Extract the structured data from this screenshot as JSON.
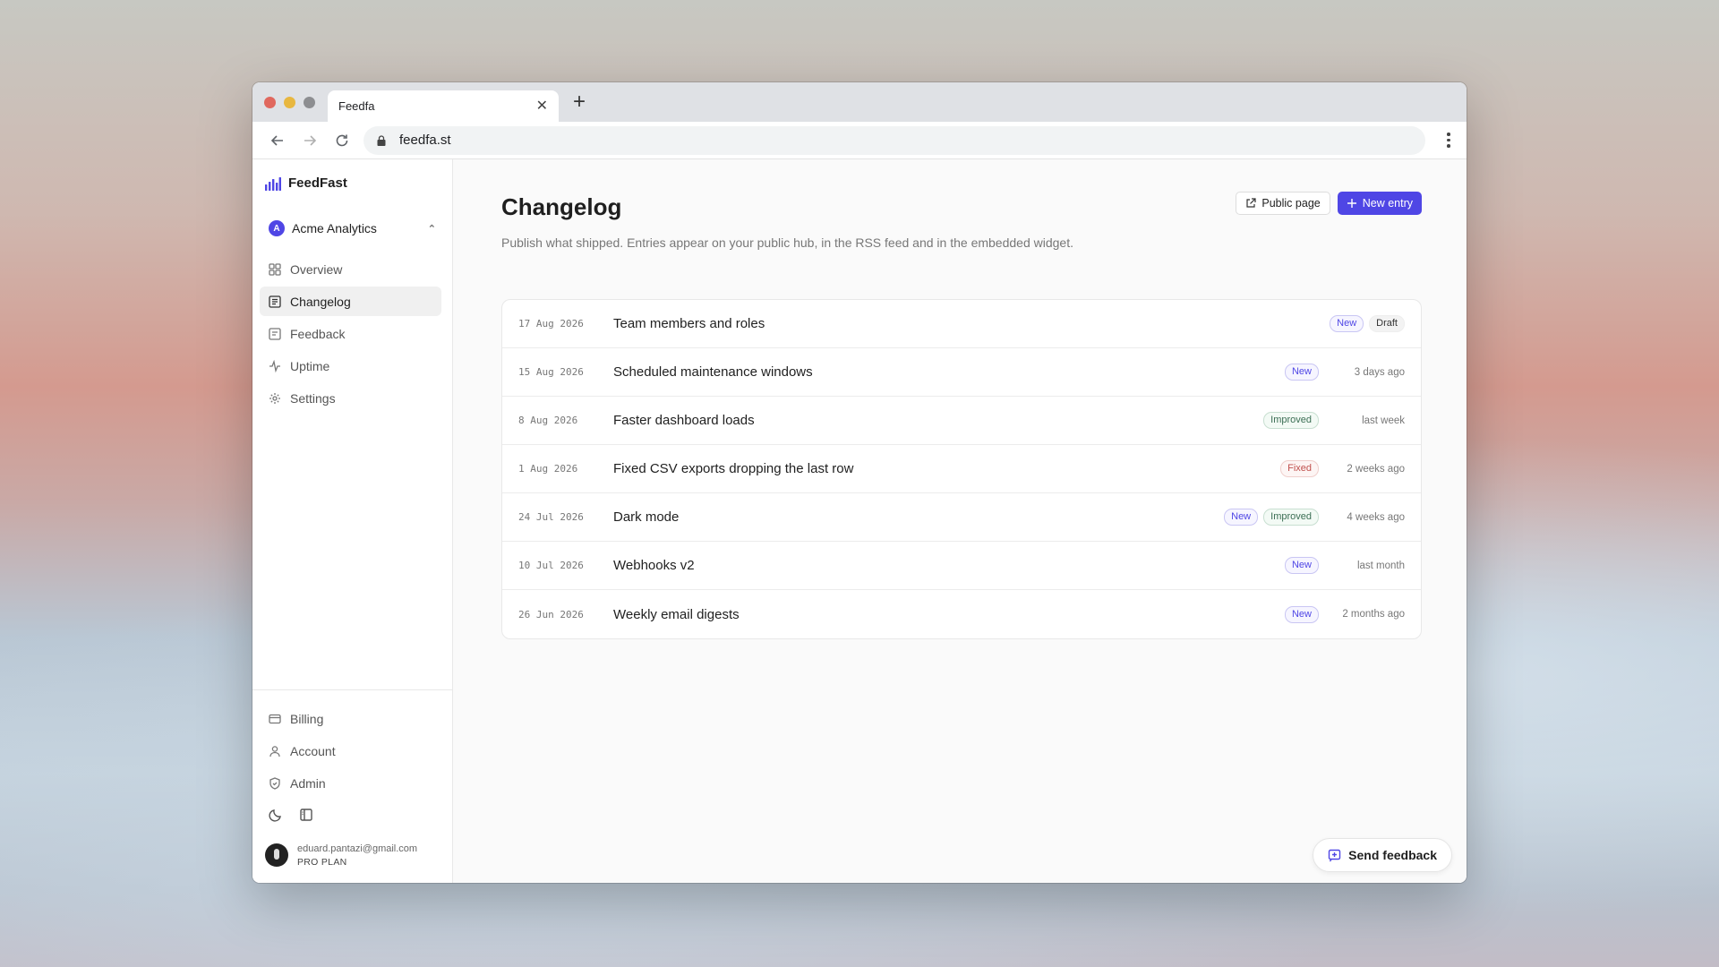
{
  "browser": {
    "tab_title": "Feedfa",
    "url": "feedfa.st"
  },
  "sidebar": {
    "brand": "FeedFast",
    "org": {
      "badge": "A",
      "name": "Acme Analytics"
    },
    "items": [
      {
        "label": "Overview",
        "icon": "grid-icon"
      },
      {
        "label": "Changelog",
        "icon": "changelog-icon",
        "active": true
      },
      {
        "label": "Feedback",
        "icon": "message-icon"
      },
      {
        "label": "Uptime",
        "icon": "activity-icon"
      },
      {
        "label": "Settings",
        "icon": "gear-icon"
      }
    ],
    "bottom_items": [
      {
        "label": "Billing",
        "icon": "credit-card-icon"
      },
      {
        "label": "Account",
        "icon": "user-icon"
      },
      {
        "label": "Admin",
        "icon": "shield-icon"
      }
    ],
    "user": {
      "email": "eduard.pantazi@gmail.com",
      "plan": "PRO PLAN"
    }
  },
  "main": {
    "title": "Changelog",
    "description": "Publish what shipped. Entries appear on your public hub, in the RSS feed and in the embedded widget.",
    "public_page_label": "Public page",
    "new_entry_label": "New entry",
    "entries": [
      {
        "date": "17 Aug 2026",
        "title": "Team members and roles",
        "badges": [
          "New"
        ],
        "status": "Draft",
        "time": ""
      },
      {
        "date": "15 Aug 2026",
        "title": "Scheduled maintenance windows",
        "badges": [
          "New"
        ],
        "time": "3 days ago"
      },
      {
        "date": "8 Aug 2026",
        "title": "Faster dashboard loads",
        "badges": [
          "Improved"
        ],
        "time": "last week"
      },
      {
        "date": "1 Aug 2026",
        "title": "Fixed CSV exports dropping the last row",
        "badges": [
          "Fixed"
        ],
        "time": "2 weeks ago"
      },
      {
        "date": "24 Jul 2026",
        "title": "Dark mode",
        "badges": [
          "New",
          "Improved"
        ],
        "time": "4 weeks ago"
      },
      {
        "date": "10 Jul 2026",
        "title": "Webhooks v2",
        "badges": [
          "New"
        ],
        "time": "last month"
      },
      {
        "date": "26 Jun 2026",
        "title": "Weekly email digests",
        "badges": [
          "New"
        ],
        "time": "2 months ago"
      }
    ],
    "send_feedback_label": "Send feedback"
  },
  "colors": {
    "accent": "#4f46e5"
  }
}
